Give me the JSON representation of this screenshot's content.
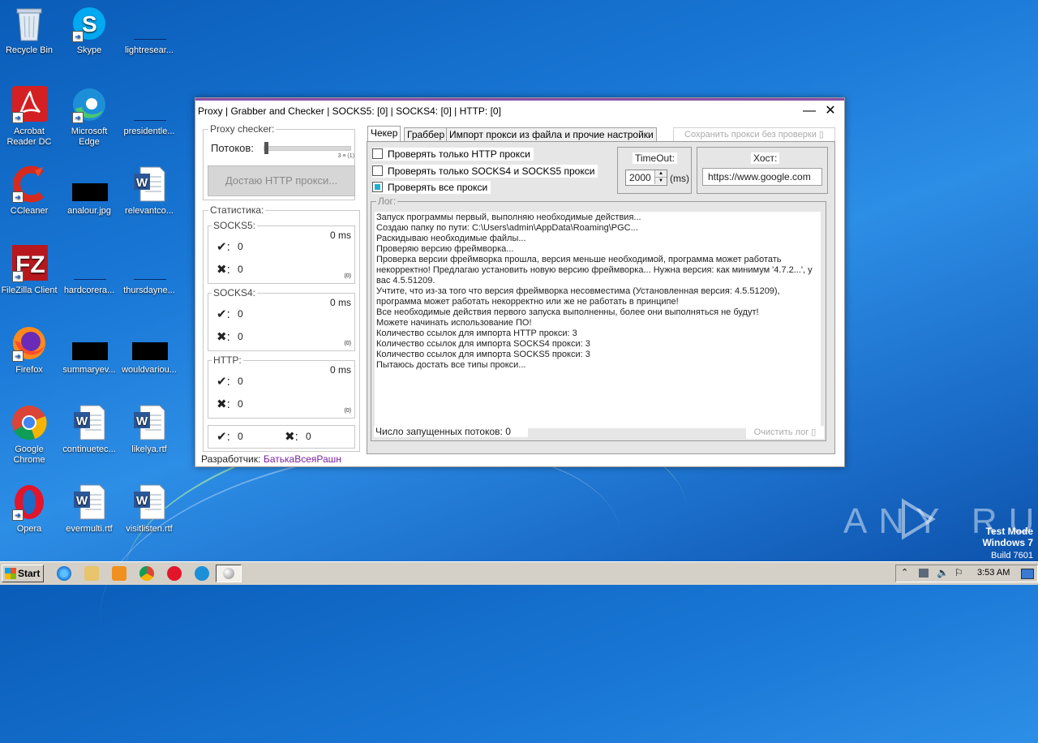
{
  "desktop": {
    "icons": [
      {
        "label": "Recycle Bin"
      },
      {
        "label": "Skype"
      },
      {
        "label": "lightresear..."
      },
      {
        "label": "Acrobat Reader DC"
      },
      {
        "label": "Microsoft Edge"
      },
      {
        "label": "presidentle..."
      },
      {
        "label": "CCleaner"
      },
      {
        "label": "analour.jpg"
      },
      {
        "label": "relevantco..."
      },
      {
        "label": "FileZilla Client"
      },
      {
        "label": "hardcorera..."
      },
      {
        "label": "thursdayne..."
      },
      {
        "label": "Firefox"
      },
      {
        "label": "summaryev..."
      },
      {
        "label": "wouldvariou..."
      },
      {
        "label": "Google Chrome"
      },
      {
        "label": "continuetec..."
      },
      {
        "label": "likelya.rtf"
      },
      {
        "label": "Opera"
      },
      {
        "label": "evermulti.rtf"
      },
      {
        "label": "visitlisten.rtf"
      }
    ],
    "watermark": {
      "brand": "ANY RUN",
      "mode": "Test Mode",
      "os": "Windows 7",
      "build": "Build 7601"
    }
  },
  "window": {
    "title": "Proxy | Grabber and Checker | SOCKS5: [0] | SOCKS4: [0] | HTTP: [0]",
    "minimize": "—",
    "close": "✕",
    "proxy_checker": {
      "group_title": "Proxy checker:",
      "threads_label": "Потоков:",
      "threads_value": "3 ≡ (1)",
      "slider_value": 0.0,
      "button": "Достаю HTTP прокси..."
    },
    "stats": {
      "group_title": "Статистика:",
      "ok_symbol": "✔:",
      "fail_symbol": "✖:",
      "blocks": [
        {
          "title": "SOCKS5:",
          "ms": "0 ms",
          "ok": "0",
          "fail": "0",
          "count": "(0)"
        },
        {
          "title": "SOCKS4:",
          "ms": "0 ms",
          "ok": "0",
          "fail": "0",
          "count": "(0)"
        },
        {
          "title": "HTTP:",
          "ms": "0 ms",
          "ok": "0",
          "fail": "0",
          "count": "(0)"
        }
      ],
      "total_ok": "0",
      "total_fail": "0"
    },
    "developer_label": "Разработчик:",
    "developer_name": "БатькаВсеяРашн",
    "tabs": [
      "Чекер",
      "Граббер",
      "Импорт прокси из файла и прочие настройки"
    ],
    "save_button": "Сохранить прокси без проверки ▯",
    "options": [
      {
        "label": "Проверять только HTTP прокси",
        "checked": false
      },
      {
        "label": "Проверять только SOCKS4 и SOCKS5 прокси",
        "checked": false
      },
      {
        "label": "Проверять все прокси",
        "checked": true
      }
    ],
    "timeout": {
      "title": "TimeOut:",
      "value": "2000",
      "unit": "(ms)"
    },
    "host": {
      "title": "Хост:",
      "value": "https://www.google.com"
    },
    "log": {
      "title": "Лог:",
      "lines": [
        "Запуск программы первый, выполняю необходимые действия...",
        "Создаю папку по пути: C:\\Users\\admin\\AppData\\Roaming\\PGC...",
        "Раскидываю необходимые файлы...",
        "Проверяю версию фреймворка...",
        "Проверка версии фреймворка прошла, версия меньше необходимой, программа может работать",
        "некорректно! Предлагаю установить новую версию фреймворка... Нужна версия: как минимум '4.7.2...', у",
        "вас 4.5.51209.",
        "Учтите, что из-за того что версия фреймворка несовместима (Установленная версия: 4.5.51209),",
        "программа может работать некорректно или же не работать в принципе!",
        "Все необходимые действия первого запуска выполненны, более они выполняться не будут!",
        "Можете начинать использование ПО!",
        "Количество ссылок для импорта HTTP прокси: 3",
        "Количество ссылок для импорта SOCKS4 прокси: 3",
        "Количество ссылок для импорта SOCKS5 прокси: 3",
        "Пытаюсь достать все типы прокси..."
      ]
    },
    "threads_running": "Число запущенных потоков: 0",
    "clear_log": "Очистить лог ▯"
  },
  "taskbar": {
    "start": "Start",
    "time": "3:53 AM"
  }
}
